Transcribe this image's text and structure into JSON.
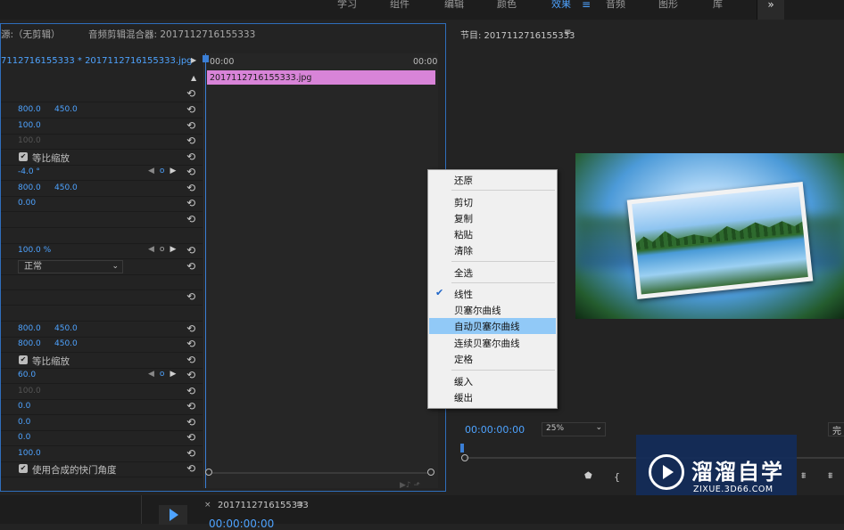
{
  "workspaces": [
    {
      "label": "学习",
      "active": false
    },
    {
      "label": "组件",
      "active": false
    },
    {
      "label": "编辑",
      "active": false
    },
    {
      "label": "颜色",
      "active": false
    },
    {
      "label": "效果",
      "active": true
    },
    {
      "label": "音频",
      "active": false
    },
    {
      "label": "图形",
      "active": false
    },
    {
      "label": "库",
      "active": false
    }
  ],
  "workspace_menu_icon": "≡",
  "workspace_more": "»",
  "left_panel": {
    "source_tab": "源:（无剪辑）",
    "mixer_tab": "音频剪辑混合器: 2017112716155333",
    "clip_path": "7112716155333 * 2017112716155333.jpg",
    "timecode_start": "00:00",
    "timecode_end": "00:00",
    "clip_label": "2017112716155333.jpg",
    "rows": {
      "position": {
        "x": "800.0",
        "y": "450.0"
      },
      "scale": "100.0",
      "scale_width": "100.0",
      "uniform_scale_label": "等比缩放",
      "rotation": "-4.0 °",
      "anchor": {
        "x": "800.0",
        "y": "450.0"
      },
      "flicker": "0.00",
      "opacity": "100.0 %",
      "blend_mode": "正常",
      "position2": {
        "x": "800.0",
        "y": "450.0"
      },
      "anchor2": {
        "x": "800.0",
        "y": "450.0"
      },
      "uniform_scale_label2": "等比缩放",
      "value_60": "60.0",
      "value_100g": "100.0",
      "v1": "0.0",
      "v2": "0.0",
      "v3": "0.0",
      "v4": "100.0",
      "shutter_label": "使用合成的快门角度"
    }
  },
  "monitor": {
    "title": "节目: 2017112716155333",
    "menu_icon": "≡",
    "timecode": "00:00:00:00",
    "zoom": "25%",
    "fit": "完"
  },
  "context_menu": {
    "items": [
      {
        "label": "还原"
      },
      {
        "label": "剪切"
      },
      {
        "label": "复制"
      },
      {
        "label": "粘贴"
      },
      {
        "label": "清除"
      },
      {
        "label": "全选"
      },
      {
        "label": "线性",
        "checked": true
      },
      {
        "label": "贝塞尔曲线"
      },
      {
        "label": "自动贝塞尔曲线",
        "highlighted": true
      },
      {
        "label": "连续贝塞尔曲线"
      },
      {
        "label": "定格"
      },
      {
        "label": "缓入"
      },
      {
        "label": "缓出"
      }
    ]
  },
  "watermark": {
    "title": "溜溜自学",
    "subtitle": "ZIXUE.3D66.COM"
  },
  "bottom": {
    "close": "×",
    "title": "2017112716155333",
    "menu_icon": "≡",
    "timecode": "00:00:00:00"
  },
  "colors": {
    "accent": "#4ea3ff",
    "clip": "#d884d8",
    "menu_highlight": "#91c9f7",
    "panel_border": "#2f6ebc"
  }
}
